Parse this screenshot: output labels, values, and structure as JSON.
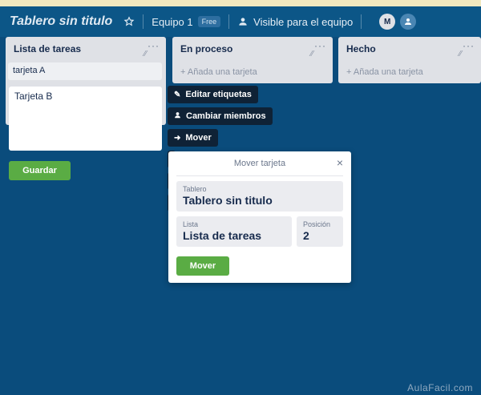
{
  "header": {
    "board_title": "Tablero sin titulo",
    "team": "Equipo 1",
    "team_badge": "Free",
    "visibility": "Visible para el equipo",
    "avatar_initial": "M"
  },
  "lists": [
    {
      "title": "Lista de tareas",
      "add_card": ""
    },
    {
      "title": "En proceso",
      "add_card": "+ Añada una tarjeta"
    },
    {
      "title": "Hecho",
      "add_card": "+ Añada una tarjeta"
    }
  ],
  "cards": {
    "card_a": "tarjeta A",
    "card_b_text": "Tarjeta B",
    "save_label": "Guardar"
  },
  "quick_actions": {
    "edit_labels": "Editar etiquetas",
    "change_members": "Cambiar miembros",
    "move": "Mover"
  },
  "move_dialog": {
    "title": "Mover tarjeta",
    "close_glyph": "×",
    "board_label": "Tablero",
    "board_value": "Tablero sin titulo",
    "list_label": "Lista",
    "list_value": "Lista de tareas",
    "position_label": "Posición",
    "position_value": "2",
    "move_button": "Mover"
  },
  "watermark": "AulaFacil.com",
  "icons": {
    "star": "star-icon",
    "visibility": "team-visibility-icon",
    "pencil": "pencil-icon",
    "member": "member-icon",
    "arrow": "arrow-right-icon"
  },
  "colors": {
    "board_bg": "#0a4c7c",
    "header_bg": "#0c5687",
    "green": "#5aac44",
    "quick_btn_bg": "#0f2236"
  }
}
